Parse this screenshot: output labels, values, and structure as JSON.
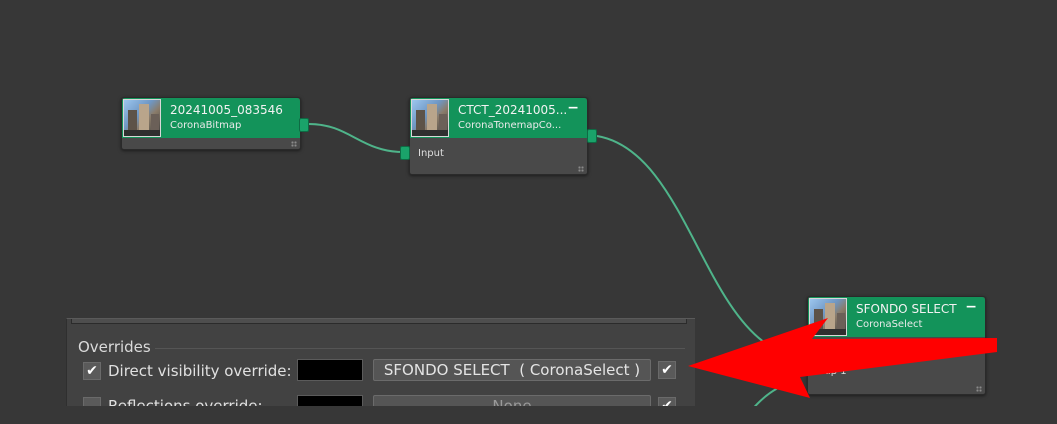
{
  "editor": {
    "nodes": {
      "bitmap": {
        "title": "20241005_083546",
        "subtitle": "CoronaBitmap",
        "icon": "image-thumbnail"
      },
      "tonemap": {
        "title": "CTCT_20241005...",
        "subtitle": "CoronaTonemapCo...",
        "collapse": "−",
        "input_label": "Input"
      },
      "select": {
        "title": "SFONDO SELECT",
        "subtitle": "CoronaSelect",
        "collapse": "−",
        "slot_label": "Map 1"
      }
    },
    "colors": {
      "header": "#13935a",
      "wire": "#4fb48a",
      "arrow": "#ff0000"
    }
  },
  "overrides": {
    "title": "Overrides",
    "rows": [
      {
        "checked": "✔",
        "label": "Direct visibility override:",
        "map_button": "SFONDO SELECT  ( CoronaSelect )",
        "enable_check": "✔"
      },
      {
        "checked": "",
        "label": "Reflections override:",
        "map_button": "None",
        "enable_check": "✔"
      }
    ]
  }
}
